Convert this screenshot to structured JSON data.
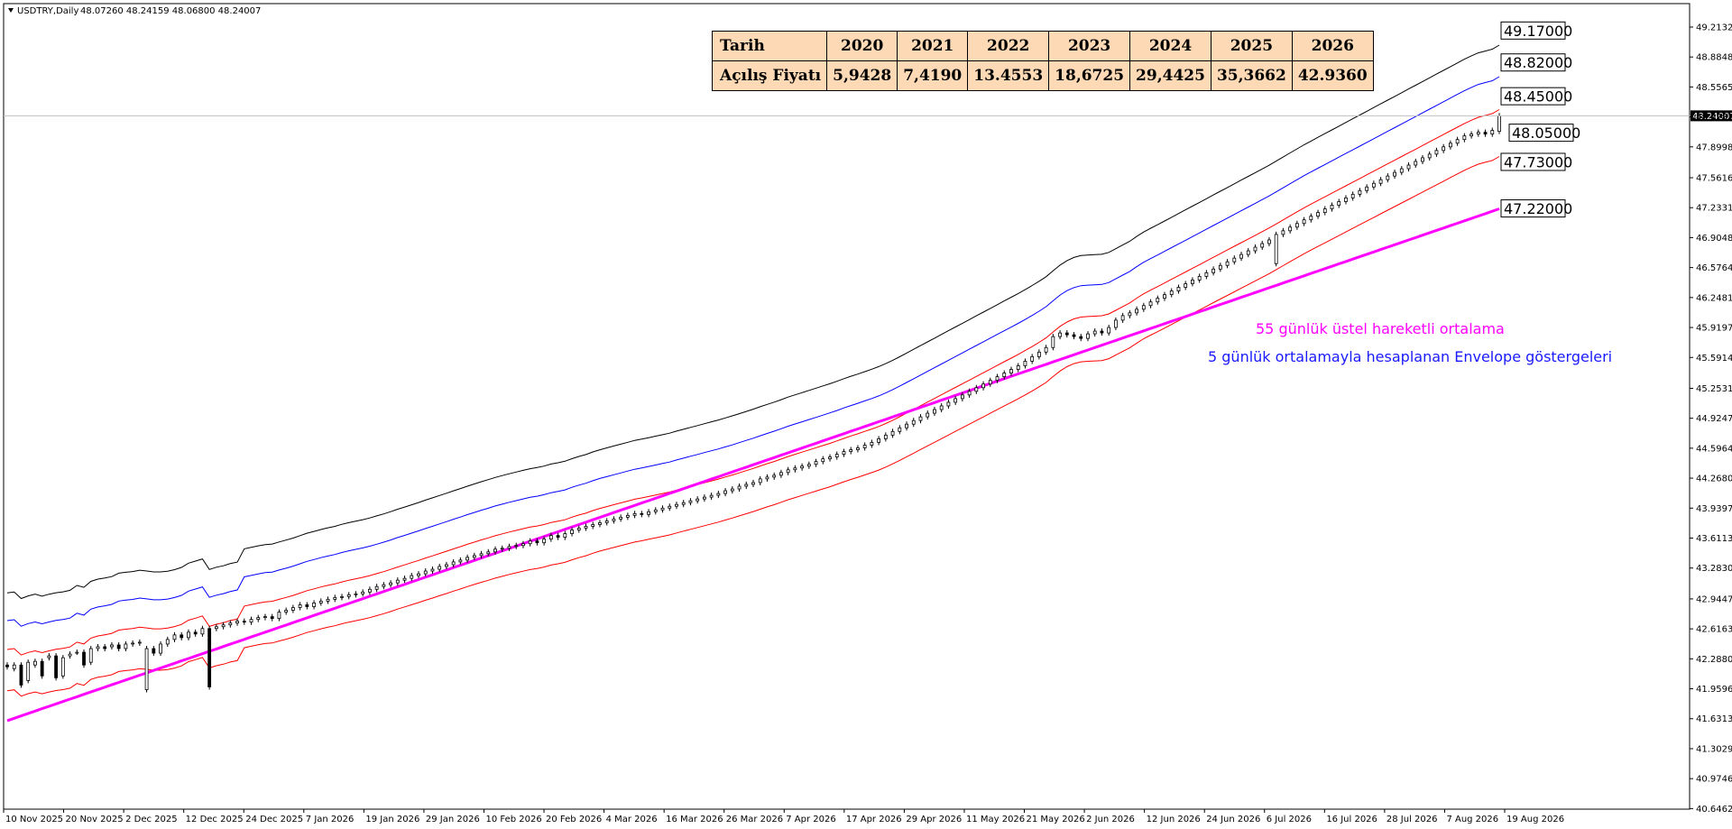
{
  "header": {
    "symbol": "USDTRY,Daily",
    "ohlc": "48.07260 48.24159 48.06800 48.24007"
  },
  "table": {
    "row1_label": "Tarih",
    "row2_label": "Açılış Fiyatı",
    "years": [
      "2020",
      "2021",
      "2022",
      "2023",
      "2024",
      "2025",
      "2026"
    ],
    "prices": [
      "5,9428",
      "7,4190",
      "13.4553",
      "18,6725",
      "29,4425",
      "35,3662",
      "42.9360"
    ]
  },
  "annotations": {
    "ema": "55 günlük üstel hareketli ortalama",
    "envelope": "5 günlük ortalamayla hesaplanan Envelope göstergeleri"
  },
  "colors": {
    "ema": "#ff00ff",
    "env_black": "#000000",
    "env_blue": "#0000ff",
    "env_red": "#ff0000",
    "background": "#ffffff",
    "table_bg": "#fdd9b5"
  },
  "chart_data": {
    "type": "candlestick",
    "ylim": [
      40.64,
      49.47
    ],
    "current_price": "48.24007",
    "y_ticks": [
      "49.21320",
      "48.88484",
      "48.55650",
      "48.22815",
      "47.89980",
      "47.56160",
      "47.23315",
      "46.90480",
      "46.57645",
      "46.24810",
      "45.91975",
      "45.59140",
      "45.25310",
      "44.92475",
      "44.59640",
      "44.26805",
      "43.93970",
      "43.61135",
      "43.28300",
      "42.94470",
      "42.61635",
      "42.28800",
      "41.95965",
      "41.63130",
      "41.30295",
      "40.97460",
      "40.64625"
    ],
    "x_ticks": [
      "10 Nov 2025",
      "20 Nov 2025",
      "2 Dec 2025",
      "12 Dec 2025",
      "24 Dec 2025",
      "7 Jan 2026",
      "19 Jan 2026",
      "29 Jan 2026",
      "10 Feb 2026",
      "20 Feb 2026",
      "4 Mar 2026",
      "16 Mar 2026",
      "26 Mar 2026",
      "7 Apr 2026",
      "17 Apr 2026",
      "29 Apr 2026",
      "11 May 2026",
      "21 May 2026",
      "2 Jun 2026",
      "12 Jun 2026",
      "24 Jun 2026",
      "6 Jul 2026",
      "16 Jul 2026",
      "28 Jul 2026",
      "7 Aug 2026",
      "19 Aug 2026"
    ],
    "levels": [
      {
        "label": "49.17000",
        "value": 49.17
      },
      {
        "label": "48.82000",
        "value": 48.82
      },
      {
        "label": "48.45000",
        "value": 48.45
      },
      {
        "label": "48.05000",
        "value": 48.05
      },
      {
        "label": "47.73000",
        "value": 47.73
      },
      {
        "label": "47.22000",
        "value": 47.22
      }
    ],
    "ema55": [
      {
        "x": 0,
        "y": 41.61
      },
      {
        "x": 261,
        "y": 47.22
      }
    ],
    "candles": [
      {
        "o": 42.22,
        "c": 42.2
      },
      {
        "o": 42.18,
        "c": 42.22
      },
      {
        "o": 42.22,
        "c": 42.0
      },
      {
        "o": 42.05,
        "c": 42.25
      },
      {
        "o": 42.22,
        "c": 42.26
      },
      {
        "o": 42.26,
        "c": 42.1
      },
      {
        "o": 42.3,
        "c": 42.32
      },
      {
        "o": 42.32,
        "c": 42.08
      },
      {
        "o": 42.1,
        "c": 42.3
      },
      {
        "o": 42.32,
        "c": 42.34
      },
      {
        "o": 42.36,
        "c": 42.36
      },
      {
        "o": 42.36,
        "c": 42.22
      },
      {
        "o": 42.25,
        "c": 42.4
      },
      {
        "o": 42.4,
        "c": 42.42
      },
      {
        "o": 42.42,
        "c": 42.4
      },
      {
        "o": 42.42,
        "c": 42.44
      },
      {
        "o": 42.44,
        "c": 42.4
      },
      {
        "o": 42.4,
        "c": 42.45
      },
      {
        "o": 42.45,
        "c": 42.46
      },
      {
        "o": 42.46,
        "c": 42.47
      },
      {
        "o": 41.95,
        "c": 42.4
      },
      {
        "o": 42.4,
        "c": 42.35
      },
      {
        "o": 42.35,
        "c": 42.45
      },
      {
        "o": 42.45,
        "c": 42.5
      },
      {
        "o": 42.5,
        "c": 42.55
      },
      {
        "o": 42.55,
        "c": 42.52
      },
      {
        "o": 42.52,
        "c": 42.58
      },
      {
        "o": 42.58,
        "c": 42.56
      },
      {
        "o": 42.56,
        "c": 42.62
      },
      {
        "o": 42.62,
        "c": 41.98
      },
      {
        "o": 42.62,
        "c": 42.64
      },
      {
        "o": 42.64,
        "c": 42.66
      },
      {
        "o": 42.66,
        "c": 42.68
      },
      {
        "o": 42.68,
        "c": 42.7
      },
      {
        "o": 42.7,
        "c": 42.69
      },
      {
        "o": 42.69,
        "c": 42.72
      },
      {
        "o": 42.72,
        "c": 42.74
      },
      {
        "o": 42.74,
        "c": 42.75
      },
      {
        "o": 42.75,
        "c": 42.73
      },
      {
        "o": 42.73,
        "c": 42.8
      },
      {
        "o": 42.8,
        "c": 42.82
      },
      {
        "o": 42.82,
        "c": 42.85
      },
      {
        "o": 42.85,
        "c": 42.88
      },
      {
        "o": 42.88,
        "c": 42.86
      },
      {
        "o": 42.86,
        "c": 42.9
      },
      {
        "o": 42.9,
        "c": 42.92
      },
      {
        "o": 42.92,
        "c": 42.94
      },
      {
        "o": 42.94,
        "c": 42.96
      },
      {
        "o": 42.96,
        "c": 42.97
      },
      {
        "o": 42.97,
        "c": 42.99
      },
      {
        "o": 42.99,
        "c": 43.0
      },
      {
        "o": 43.0,
        "c": 43.02
      },
      {
        "o": 43.02,
        "c": 43.05
      },
      {
        "o": 43.05,
        "c": 43.08
      },
      {
        "o": 43.08,
        "c": 43.1
      },
      {
        "o": 43.1,
        "c": 43.12
      },
      {
        "o": 43.12,
        "c": 43.15
      },
      {
        "o": 43.15,
        "c": 43.17
      },
      {
        "o": 43.17,
        "c": 43.2
      },
      {
        "o": 43.2,
        "c": 43.22
      },
      {
        "o": 43.22,
        "c": 43.25
      },
      {
        "o": 43.25,
        "c": 43.27
      },
      {
        "o": 43.27,
        "c": 43.3
      },
      {
        "o": 43.3,
        "c": 43.32
      },
      {
        "o": 43.32,
        "c": 43.35
      },
      {
        "o": 43.35,
        "c": 43.37
      },
      {
        "o": 43.37,
        "c": 43.4
      },
      {
        "o": 43.4,
        "c": 43.42
      },
      {
        "o": 43.42,
        "c": 43.44
      },
      {
        "o": 43.44,
        "c": 43.46
      },
      {
        "o": 43.46,
        "c": 43.49
      },
      {
        "o": 43.49,
        "c": 43.5
      },
      {
        "o": 43.5,
        "c": 43.52
      },
      {
        "o": 43.52,
        "c": 43.53
      },
      {
        "o": 43.53,
        "c": 43.55
      },
      {
        "o": 43.55,
        "c": 43.58
      },
      {
        "o": 43.58,
        "c": 43.56
      },
      {
        "o": 43.56,
        "c": 43.6
      },
      {
        "o": 43.6,
        "c": 43.64
      },
      {
        "o": 43.64,
        "c": 43.62
      },
      {
        "o": 43.62,
        "c": 43.66
      },
      {
        "o": 43.66,
        "c": 43.7
      },
      {
        "o": 43.7,
        "c": 43.72
      },
      {
        "o": 43.72,
        "c": 43.74
      },
      {
        "o": 43.74,
        "c": 43.76
      },
      {
        "o": 43.76,
        "c": 43.78
      },
      {
        "o": 43.78,
        "c": 43.8
      },
      {
        "o": 43.8,
        "c": 43.82
      },
      {
        "o": 43.82,
        "c": 43.84
      },
      {
        "o": 43.84,
        "c": 43.86
      },
      {
        "o": 43.86,
        "c": 43.88
      },
      {
        "o": 43.88,
        "c": 43.87
      },
      {
        "o": 43.87,
        "c": 43.9
      },
      {
        "o": 43.9,
        "c": 43.92
      },
      {
        "o": 43.92,
        "c": 43.94
      },
      {
        "o": 43.94,
        "c": 43.96
      },
      {
        "o": 43.96,
        "c": 43.98
      },
      {
        "o": 43.98,
        "c": 44.0
      },
      {
        "o": 44.0,
        "c": 44.02
      },
      {
        "o": 44.02,
        "c": 44.04
      },
      {
        "o": 44.04,
        "c": 44.06
      },
      {
        "o": 44.06,
        "c": 44.08
      },
      {
        "o": 44.08,
        "c": 44.1
      },
      {
        "o": 44.1,
        "c": 44.13
      },
      {
        "o": 44.13,
        "c": 44.15
      },
      {
        "o": 44.15,
        "c": 44.18
      },
      {
        "o": 44.18,
        "c": 44.2
      },
      {
        "o": 44.2,
        "c": 44.22
      },
      {
        "o": 44.22,
        "c": 44.26
      },
      {
        "o": 44.26,
        "c": 44.28
      },
      {
        "o": 44.28,
        "c": 44.3
      },
      {
        "o": 44.3,
        "c": 44.33
      },
      {
        "o": 44.33,
        "c": 44.36
      },
      {
        "o": 44.36,
        "c": 44.38
      },
      {
        "o": 44.38,
        "c": 44.4
      },
      {
        "o": 44.4,
        "c": 44.42
      },
      {
        "o": 44.42,
        "c": 44.45
      },
      {
        "o": 44.45,
        "c": 44.48
      },
      {
        "o": 44.48,
        "c": 44.5
      },
      {
        "o": 44.5,
        "c": 44.53
      },
      {
        "o": 44.53,
        "c": 44.56
      },
      {
        "o": 44.56,
        "c": 44.58
      },
      {
        "o": 44.58,
        "c": 44.6
      },
      {
        "o": 44.6,
        "c": 44.63
      },
      {
        "o": 44.63,
        "c": 44.66
      },
      {
        "o": 44.66,
        "c": 44.7
      },
      {
        "o": 44.7,
        "c": 44.74
      },
      {
        "o": 44.74,
        "c": 44.78
      },
      {
        "o": 44.78,
        "c": 44.82
      },
      {
        "o": 44.82,
        "c": 44.86
      },
      {
        "o": 44.86,
        "c": 44.9
      },
      {
        "o": 44.9,
        "c": 44.94
      },
      {
        "o": 44.94,
        "c": 44.98
      },
      {
        "o": 44.98,
        "c": 45.02
      },
      {
        "o": 45.02,
        "c": 45.06
      },
      {
        "o": 45.06,
        "c": 45.1
      },
      {
        "o": 45.1,
        "c": 45.14
      },
      {
        "o": 45.14,
        "c": 45.18
      },
      {
        "o": 45.18,
        "c": 45.22
      },
      {
        "o": 45.22,
        "c": 45.26
      },
      {
        "o": 45.26,
        "c": 45.3
      },
      {
        "o": 45.3,
        "c": 45.34
      },
      {
        "o": 45.34,
        "c": 45.38
      },
      {
        "o": 45.38,
        "c": 45.42
      },
      {
        "o": 45.42,
        "c": 45.46
      },
      {
        "o": 45.46,
        "c": 45.5
      },
      {
        "o": 45.5,
        "c": 45.55
      },
      {
        "o": 45.55,
        "c": 45.6
      },
      {
        "o": 45.6,
        "c": 45.65
      },
      {
        "o": 45.65,
        "c": 45.7
      },
      {
        "o": 45.7,
        "c": 45.82
      },
      {
        "o": 45.82,
        "c": 45.86
      },
      {
        "o": 45.86,
        "c": 45.84
      },
      {
        "o": 45.84,
        "c": 45.82
      },
      {
        "o": 45.82,
        "c": 45.8
      },
      {
        "o": 45.8,
        "c": 45.85
      },
      {
        "o": 45.85,
        "c": 45.88
      },
      {
        "o": 45.88,
        "c": 45.86
      },
      {
        "o": 45.86,
        "c": 45.92
      },
      {
        "o": 45.92,
        "c": 46.0
      },
      {
        "o": 46.0,
        "c": 46.05
      },
      {
        "o": 46.05,
        "c": 46.08
      },
      {
        "o": 46.08,
        "c": 46.12
      },
      {
        "o": 46.12,
        "c": 46.16
      },
      {
        "o": 46.16,
        "c": 46.2
      },
      {
        "o": 46.2,
        "c": 46.24
      },
      {
        "o": 46.24,
        "c": 46.28
      },
      {
        "o": 46.28,
        "c": 46.32
      },
      {
        "o": 46.32,
        "c": 46.36
      },
      {
        "o": 46.36,
        "c": 46.4
      },
      {
        "o": 46.4,
        "c": 46.44
      },
      {
        "o": 46.44,
        "c": 46.48
      },
      {
        "o": 46.48,
        "c": 46.52
      },
      {
        "o": 46.52,
        "c": 46.56
      },
      {
        "o": 46.56,
        "c": 46.6
      },
      {
        "o": 46.6,
        "c": 46.64
      },
      {
        "o": 46.64,
        "c": 46.68
      },
      {
        "o": 46.68,
        "c": 46.72
      },
      {
        "o": 46.72,
        "c": 46.76
      },
      {
        "o": 46.76,
        "c": 46.8
      },
      {
        "o": 46.8,
        "c": 46.84
      },
      {
        "o": 46.84,
        "c": 46.88
      },
      {
        "o": 46.62,
        "c": 46.94
      },
      {
        "o": 46.94,
        "c": 46.98
      },
      {
        "o": 46.98,
        "c": 47.02
      },
      {
        "o": 47.02,
        "c": 47.06
      },
      {
        "o": 47.06,
        "c": 47.1
      },
      {
        "o": 47.1,
        "c": 47.14
      },
      {
        "o": 47.14,
        "c": 47.18
      },
      {
        "o": 47.18,
        "c": 47.22
      },
      {
        "o": 47.22,
        "c": 47.26
      },
      {
        "o": 47.26,
        "c": 47.3
      },
      {
        "o": 47.3,
        "c": 47.34
      },
      {
        "o": 47.34,
        "c": 47.38
      },
      {
        "o": 47.38,
        "c": 47.42
      },
      {
        "o": 47.42,
        "c": 47.46
      },
      {
        "o": 47.46,
        "c": 47.5
      },
      {
        "o": 47.5,
        "c": 47.54
      },
      {
        "o": 47.54,
        "c": 47.58
      },
      {
        "o": 47.58,
        "c": 47.62
      },
      {
        "o": 47.62,
        "c": 47.66
      },
      {
        "o": 47.66,
        "c": 47.7
      },
      {
        "o": 47.7,
        "c": 47.74
      },
      {
        "o": 47.74,
        "c": 47.78
      },
      {
        "o": 47.78,
        "c": 47.82
      },
      {
        "o": 47.82,
        "c": 47.86
      },
      {
        "o": 47.86,
        "c": 47.9
      },
      {
        "o": 47.9,
        "c": 47.94
      },
      {
        "o": 47.94,
        "c": 47.98
      },
      {
        "o": 47.98,
        "c": 48.02
      },
      {
        "o": 48.02,
        "c": 48.04
      },
      {
        "o": 48.04,
        "c": 48.06
      },
      {
        "o": 48.06,
        "c": 48.04
      },
      {
        "o": 48.04,
        "c": 48.08
      },
      {
        "o": 48.07,
        "c": 48.24
      }
    ]
  }
}
